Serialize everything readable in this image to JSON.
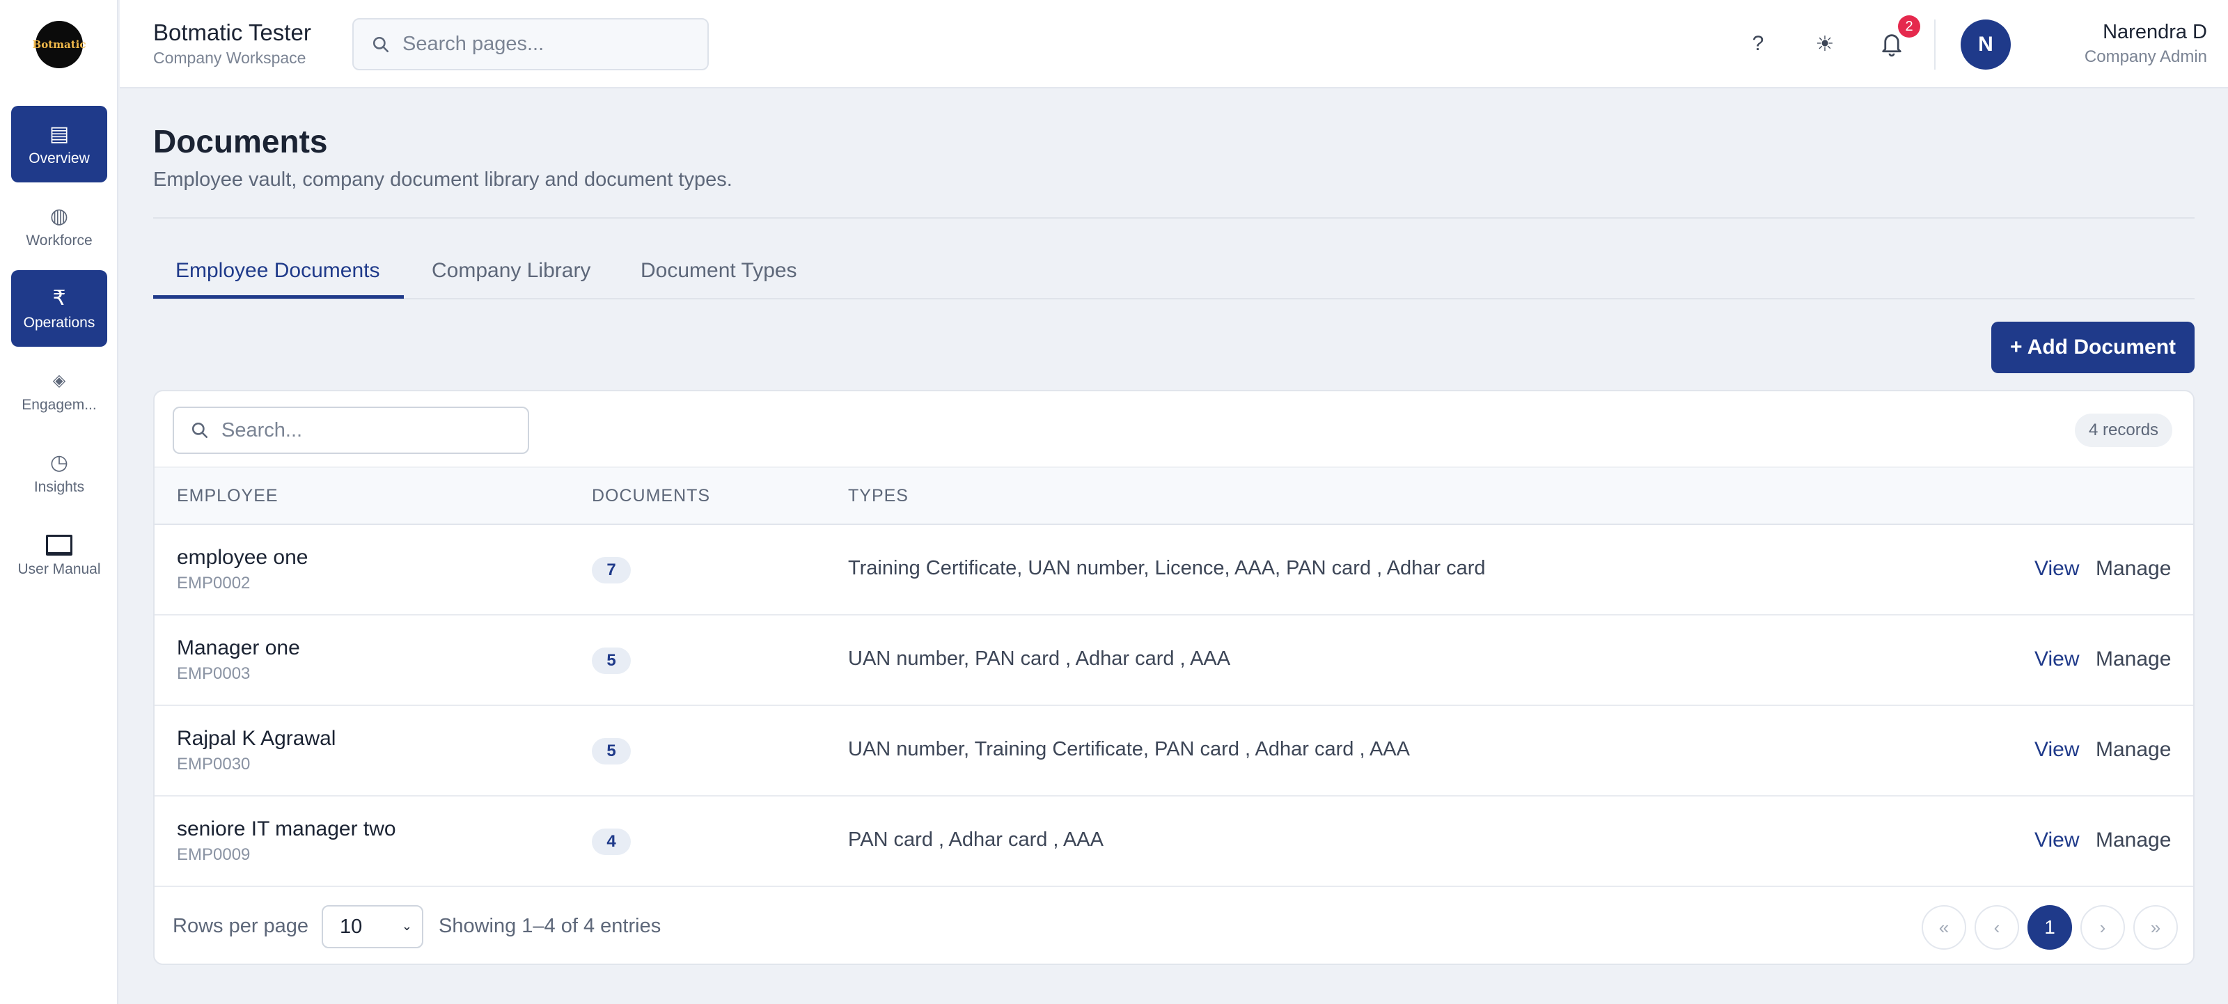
{
  "brand": {
    "logo_text": "Botmatic"
  },
  "sidebar": {
    "items": [
      {
        "label": "Overview",
        "icon": "overview-icon",
        "glyph": "▤"
      },
      {
        "label": "Workforce",
        "icon": "globe-icon",
        "glyph": "◍"
      },
      {
        "label": "Operations",
        "icon": "rupee-icon",
        "glyph": "₹"
      },
      {
        "label": "Engagem...",
        "icon": "diamond-icon",
        "glyph": "◈"
      },
      {
        "label": "Insights",
        "icon": "clock-icon",
        "glyph": "◷"
      },
      {
        "label": "User Manual",
        "icon": "book-icon",
        "glyph": ""
      }
    ]
  },
  "header": {
    "title": "Botmatic Tester",
    "subtitle": "Company Workspace",
    "search_placeholder": "Search pages...",
    "help_glyph": "?",
    "theme_glyph": "☀",
    "notification_count": "2",
    "user": {
      "initial": "N",
      "name": "Narendra D",
      "role": "Company Admin"
    }
  },
  "page": {
    "title": "Documents",
    "subtitle": "Employee vault, company document library and document types."
  },
  "tabs": [
    "Employee Documents",
    "Company Library",
    "Document Types"
  ],
  "add_button": "+ Add Document",
  "table": {
    "search_placeholder": "Search...",
    "records": "4 records",
    "columns": [
      "EMPLOYEE",
      "DOCUMENTS",
      "TYPES"
    ],
    "rows": [
      {
        "name": "employee one",
        "id": "EMP0002",
        "count": "7",
        "types": "Training Certificate, UAN number, Licence, AAA, PAN card , Adhar card",
        "view": "View",
        "manage": "Manage"
      },
      {
        "name": "Manager one",
        "id": "EMP0003",
        "count": "5",
        "types": "UAN number, PAN card , Adhar card , AAA",
        "view": "View",
        "manage": "Manage"
      },
      {
        "name": "Rajpal K Agrawal",
        "id": "EMP0030",
        "count": "5",
        "types": "UAN number, Training Certificate, PAN card , Adhar card , AAA",
        "view": "View",
        "manage": "Manage"
      },
      {
        "name": "seniore IT manager two",
        "id": "EMP0009",
        "count": "4",
        "types": "PAN card , Adhar card , AAA",
        "view": "View",
        "manage": "Manage"
      }
    ]
  },
  "pagination": {
    "rows_per_page_label": "Rows per page",
    "rows_per_page": "10",
    "showing": "Showing 1–4 of 4 entries",
    "first": "«",
    "prev": "‹",
    "current": "1",
    "next": "›",
    "last": "»"
  },
  "colors": {
    "primary": "#1f3a8a",
    "badge": "#e5294d",
    "background": "#eef1f6"
  }
}
